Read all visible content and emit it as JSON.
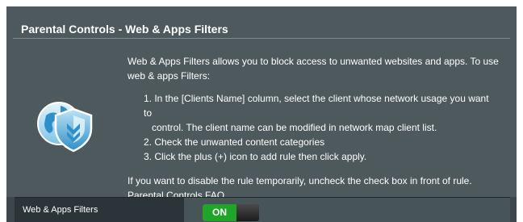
{
  "header": {
    "title": "Parental Controls - Web & Apps Filters"
  },
  "intro": {
    "lead": "Web & Apps Filters allows you to block access to unwanted websites and apps. To use web & apps Filters:",
    "steps": [
      "1. In the [Clients Name] column, select the client whose network usage you want to",
      "control. The client name can be modified in network map client list.",
      "2. Check the unwanted content categories",
      "3. Click the plus (+) icon to add rule then click apply."
    ],
    "note": "If you want to disable the rule temporarily, uncheck the check box in front of rule.",
    "faq_link": "Parental Controls FAQ",
    "logo_icon": "globe-shield-icon"
  },
  "filter": {
    "label": "Web & Apps Filters",
    "toggle_label": "ON",
    "toggle_state": "on"
  },
  "colors": {
    "panel": "#4d595d",
    "frame": "#3c464b",
    "label_cell": "#2b3438",
    "toggle_on": "#1fa629"
  }
}
